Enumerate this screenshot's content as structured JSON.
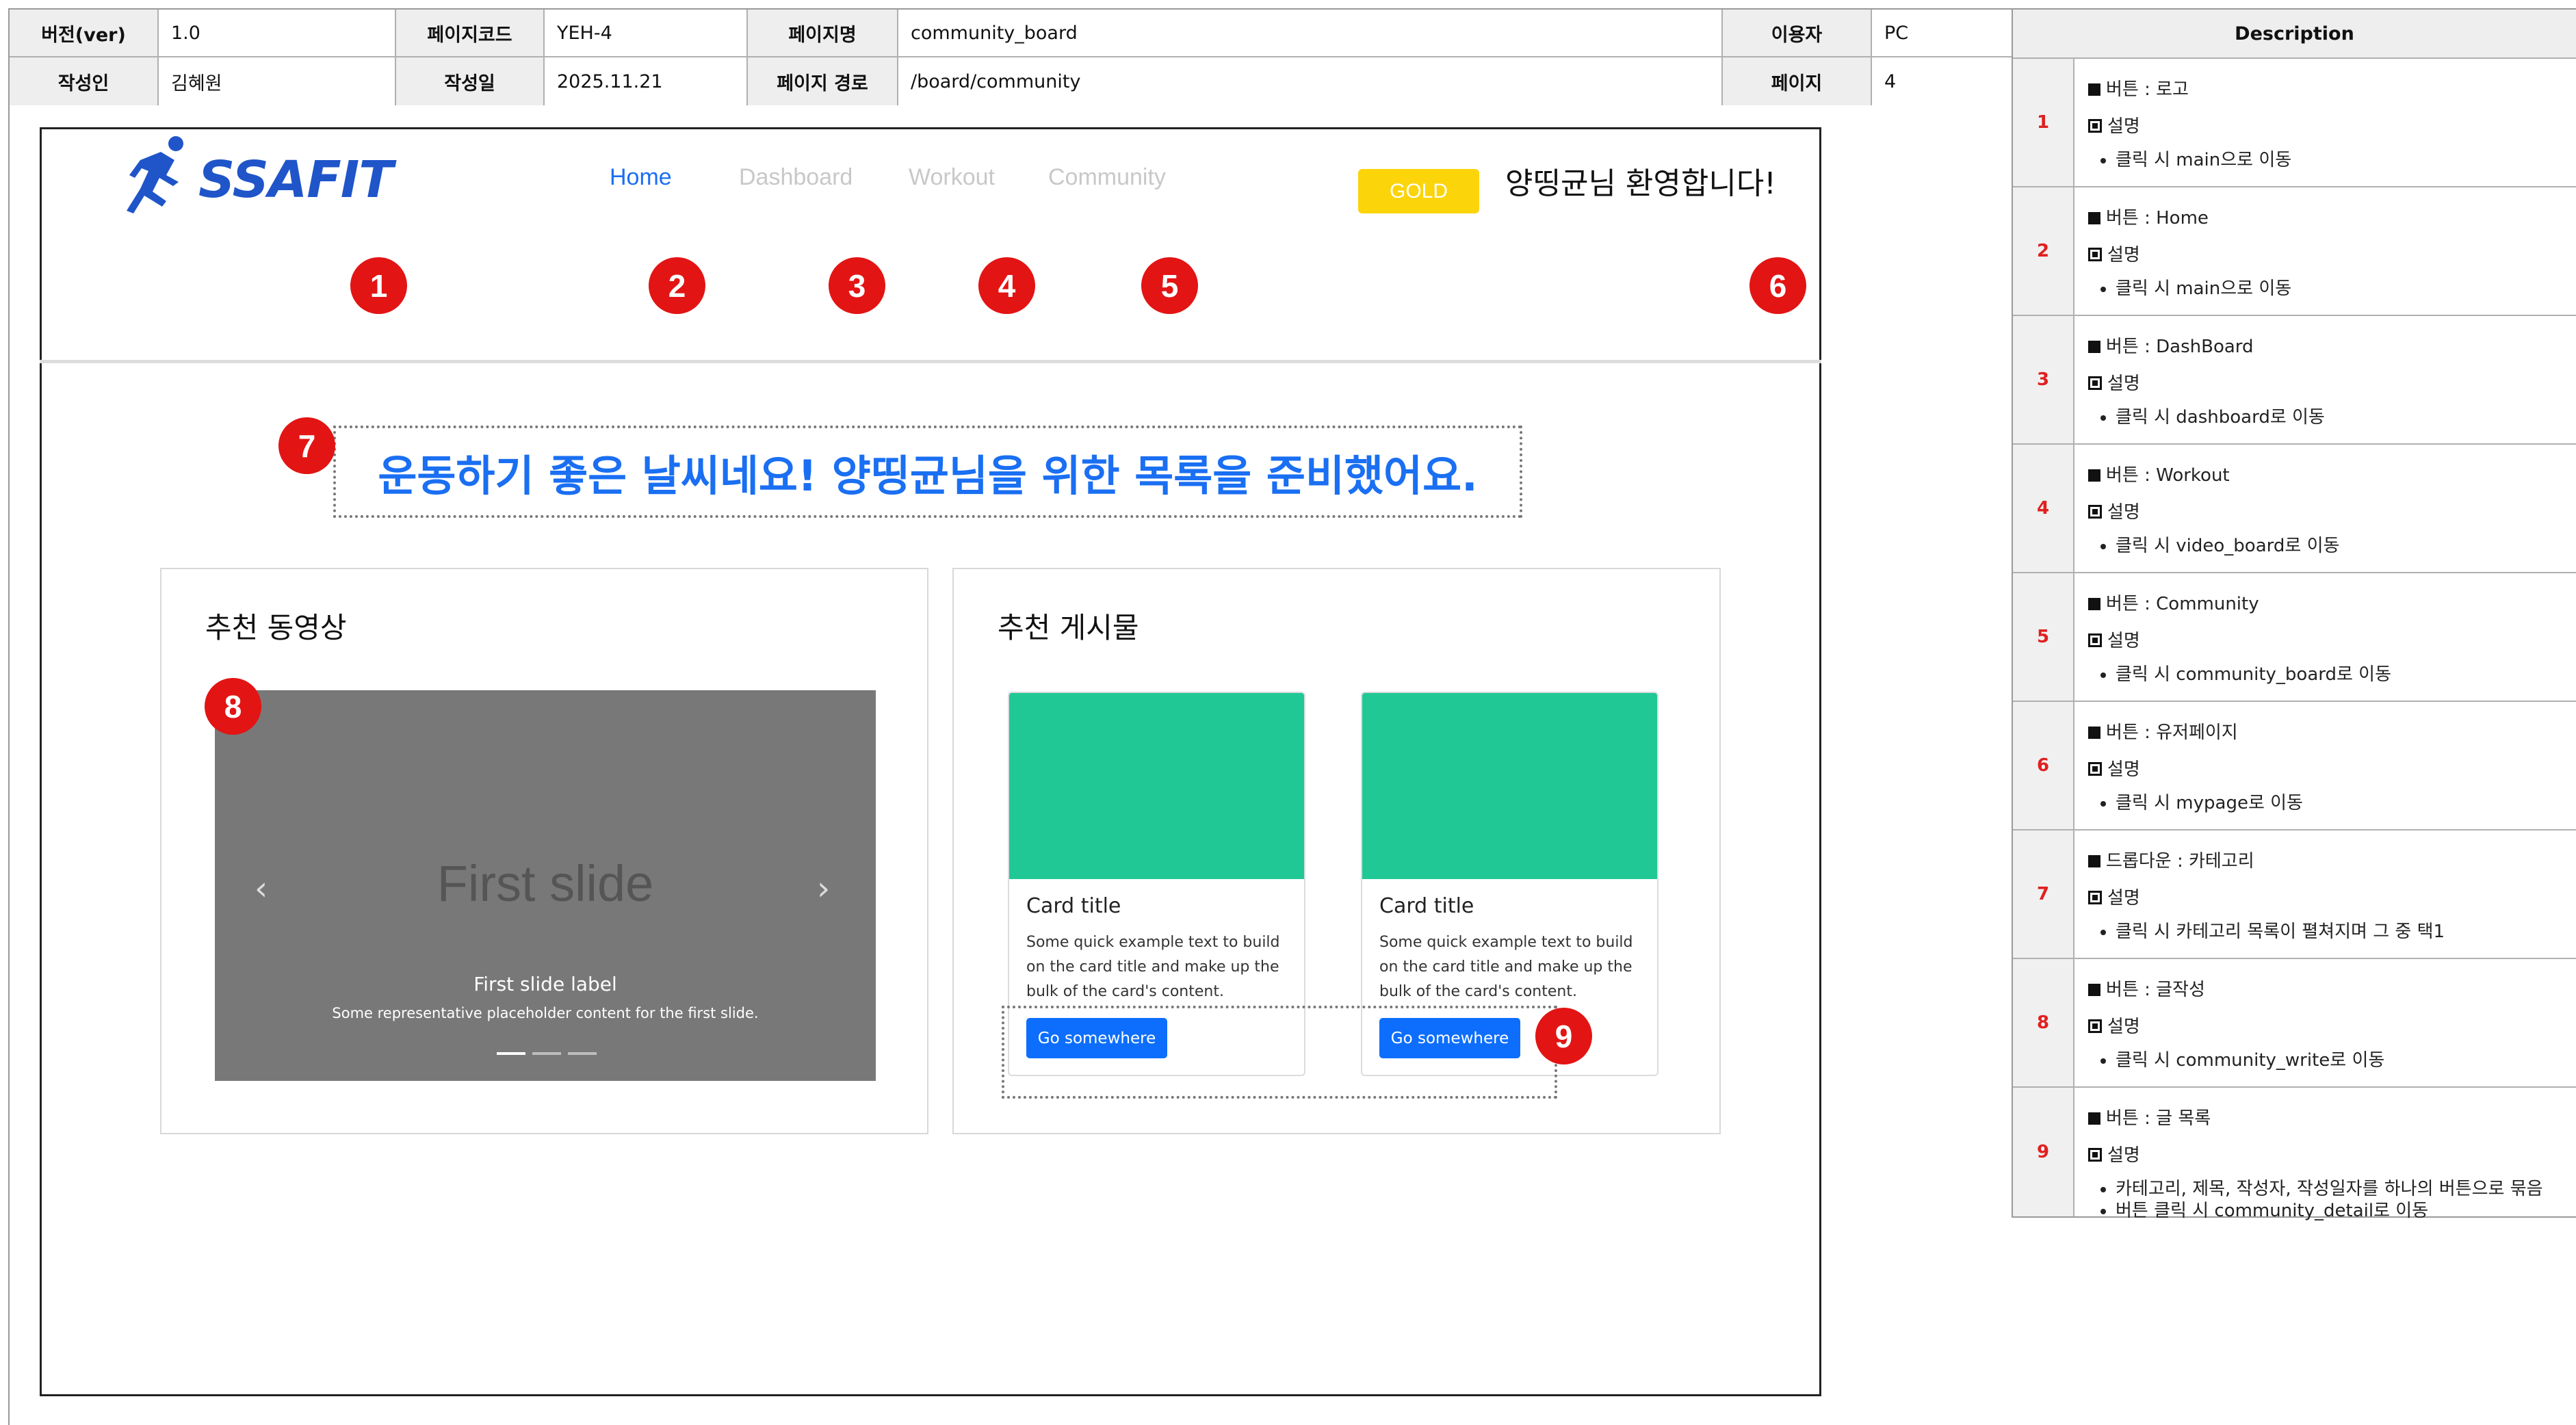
{
  "header": {
    "version_label": "버전(ver)",
    "version_value": "1.0",
    "page_code_label": "페이지코드",
    "page_code_value": "YEH-4",
    "page_name_label": "페이지명",
    "page_name_value": "community_board",
    "user_label": "이용자",
    "user_value": "PC",
    "author_label": "작성인",
    "author_value": "김혜원",
    "date_label": "작성일",
    "date_value": "2025.11.21",
    "path_label": "페이지 경로",
    "path_value": "/board/community",
    "page_label": "페이지",
    "page_value": "4"
  },
  "description": {
    "title": "Description",
    "items": [
      {
        "num": "1",
        "title": "버튼 : 로고",
        "sub": "설명",
        "points": [
          "클릭 시 main으로 이동"
        ]
      },
      {
        "num": "2",
        "title": "버튼 : Home",
        "sub": "설명",
        "points": [
          "클릭 시 main으로 이동"
        ]
      },
      {
        "num": "3",
        "title": "버튼 : DashBoard",
        "sub": "설명",
        "points": [
          "클릭 시 dashboard로 이동"
        ]
      },
      {
        "num": "4",
        "title": "버튼 : Workout",
        "sub": "설명",
        "points": [
          "클릭 시 video_board로 이동"
        ]
      },
      {
        "num": "5",
        "title": "버튼 : Community",
        "sub": "설명",
        "points": [
          "클릭 시 community_board로 이동"
        ]
      },
      {
        "num": "6",
        "title": "버튼 : 유저페이지",
        "sub": "설명",
        "points": [
          "클릭 시 mypage로 이동"
        ]
      },
      {
        "num": "7",
        "title": "드롭다운 : 카테고리",
        "sub": "설명",
        "points": [
          "클릭 시 카테고리 목록이 펼쳐지며 그 중 택1"
        ]
      },
      {
        "num": "8",
        "title": "버튼 : 글작성",
        "sub": "설명",
        "points": [
          "클릭 시 community_write로 이동"
        ]
      },
      {
        "num": "9",
        "title": "버튼 : 글 목록",
        "sub": "설명",
        "points": [
          "카테고리, 제목, 작성자, 작성일자를 하나의 버튼으로 묶음",
          "버튼 클릭 시 community_detail로 이동"
        ]
      }
    ]
  },
  "mockup": {
    "logo": "SSAFIT",
    "nav": [
      "Home",
      "Dashboard",
      "Workout",
      "Community"
    ],
    "grade_badge": "GOLD",
    "welcome": "양띵균님 환영합니다!",
    "headline": "운동하기 좋은 날씨네요! 양띵균님을 위한 목록을 준비했어요.",
    "video_section_title": "추천 동영상",
    "post_section_title": "추천 게시물",
    "carousel": {
      "slide_text": "First slide",
      "slide_label": "First slide label",
      "slide_caption": "Some representative placeholder content for the first slide.",
      "prev": "‹",
      "next": "›"
    },
    "cards": [
      {
        "title": "Card title",
        "text": "Some quick example text to build on the card title and make up the bulk of the card's content.",
        "button": "Go somewhere"
      },
      {
        "title": "Card title",
        "text": "Some quick example text to build on the card title and make up the bulk of the card's content.",
        "button": "Go somewhere"
      }
    ]
  },
  "markers": [
    "1",
    "2",
    "3",
    "4",
    "5",
    "6",
    "7",
    "8",
    "9"
  ],
  "colors": {
    "accent": "#1a6ff2",
    "marker": "#e31414",
    "gold": "#fcd40a",
    "card_image": "#20c896",
    "button": "#0d6efd"
  }
}
